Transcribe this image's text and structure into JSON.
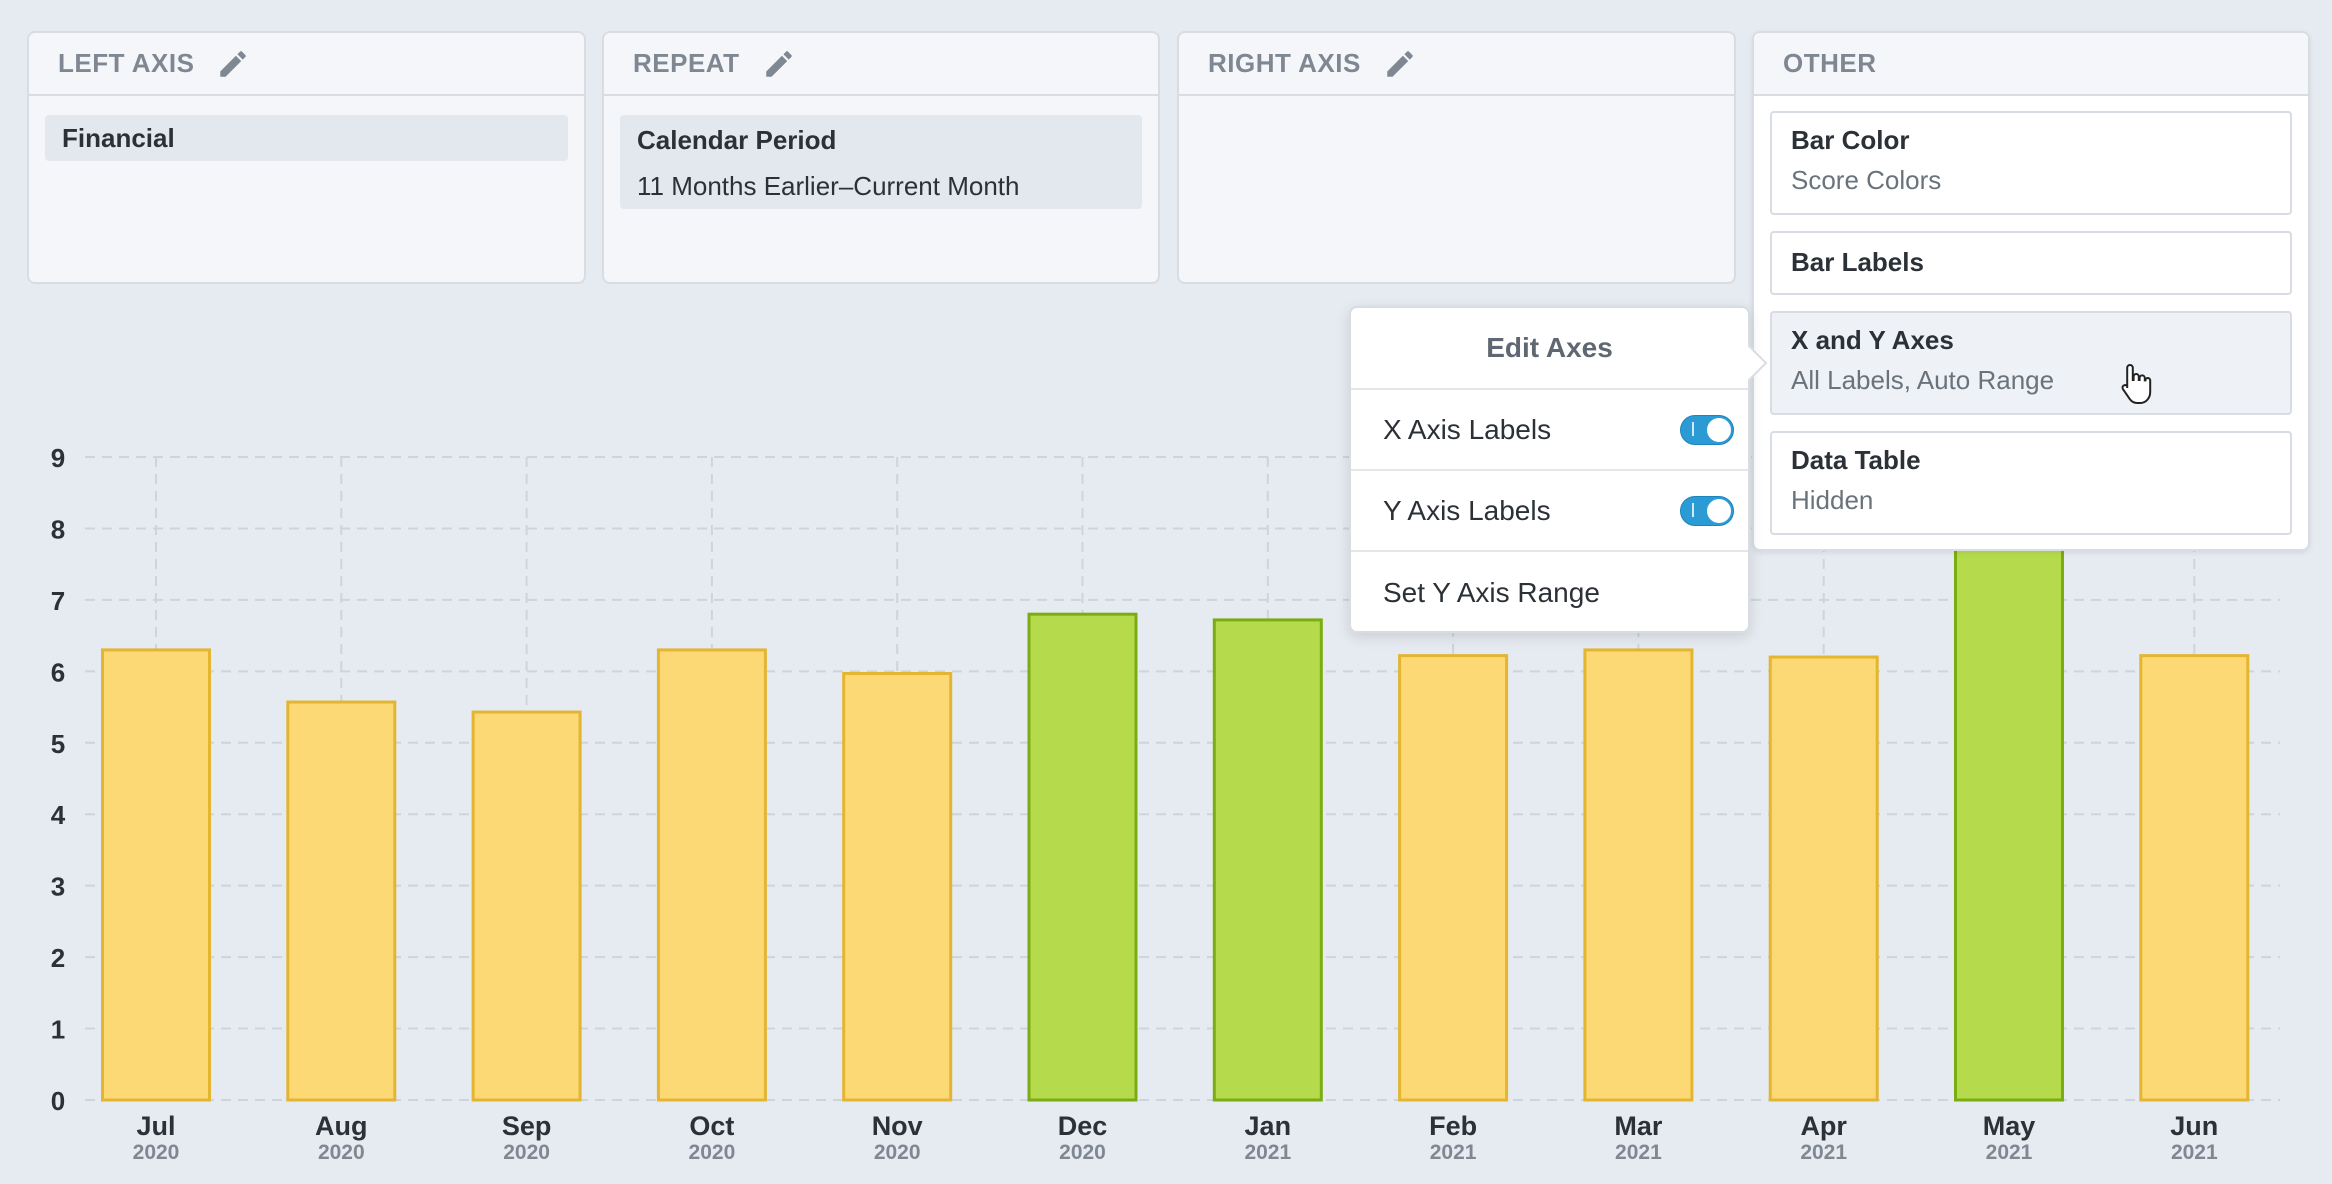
{
  "panels": {
    "left_axis": {
      "title": "LEFT AXIS",
      "chip_title": "Financial"
    },
    "repeat": {
      "title": "REPEAT",
      "chip_title": "Calendar Period",
      "chip_sub": "11 Months Earlier–Current Month"
    },
    "right_axis": {
      "title": "RIGHT AXIS"
    },
    "other": {
      "title": "OTHER",
      "options": [
        {
          "title": "Bar Color",
          "sub": "Score Colors"
        },
        {
          "title": "Bar Labels",
          "sub": ""
        },
        {
          "title": "X and Y Axes",
          "sub": "All Labels, Auto Range"
        },
        {
          "title": "Data Table",
          "sub": "Hidden"
        }
      ]
    }
  },
  "popover": {
    "title": "Edit Axes",
    "x_axis_labels": "X Axis Labels",
    "y_axis_labels": "Y Axis Labels",
    "set_range": "Set Y Axis Range",
    "x_axis_labels_on": true,
    "y_axis_labels_on": true
  },
  "colors": {
    "yellow_fill": "#fcd975",
    "yellow_stroke": "#e3b531",
    "green_fill": "#b5db4d",
    "green_stroke": "#7aad12",
    "toggle_on": "#2b9bd6"
  },
  "chart_data": {
    "type": "bar",
    "categories": [
      "Jul",
      "Aug",
      "Sep",
      "Oct",
      "Nov",
      "Dec",
      "Jan",
      "Feb",
      "Mar",
      "Apr",
      "May",
      "Jun"
    ],
    "years": [
      "2020",
      "2020",
      "2020",
      "2020",
      "2020",
      "2020",
      "2021",
      "2021",
      "2021",
      "2021",
      "2021",
      "2021"
    ],
    "values": [
      6.3,
      5.57,
      5.43,
      6.3,
      5.97,
      6.8,
      6.72,
      6.22,
      6.3,
      6.2,
      9.0,
      6.22
    ],
    "colors": [
      "yellow",
      "yellow",
      "yellow",
      "yellow",
      "yellow",
      "green",
      "green",
      "yellow",
      "yellow",
      "yellow",
      "green",
      "yellow"
    ],
    "yticks": [
      0,
      1,
      2,
      3,
      4,
      5,
      6,
      7,
      8,
      9
    ],
    "ylim": [
      0,
      9
    ],
    "grid": true
  }
}
